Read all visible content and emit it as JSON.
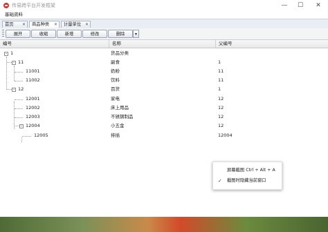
{
  "window": {
    "title": "传易跨平台开发框架",
    "controls": {
      "minimize": "—",
      "maximize": "☐",
      "close": "✕"
    }
  },
  "menu": {
    "items": [
      "基础资料"
    ]
  },
  "tabs": [
    {
      "label": "首页",
      "active": false
    },
    {
      "label": "商品种类",
      "active": true
    },
    {
      "label": "计量单位",
      "active": false
    }
  ],
  "tab_close_glyph": "✕",
  "toolbar": {
    "buttons": [
      "展开",
      "收缩",
      "新增",
      "修改",
      "删除"
    ],
    "more_glyph": "▾"
  },
  "grid": {
    "columns": [
      "编号",
      "名称",
      "父编号"
    ],
    "rows": [
      {
        "code": "1",
        "name": "货品分类",
        "parent": "",
        "level": 0,
        "expander": "-"
      },
      {
        "code": "11",
        "name": "副食",
        "parent": "1",
        "level": 1,
        "expander": "-"
      },
      {
        "code": "11001",
        "name": "奶粉",
        "parent": "11",
        "level": 2,
        "expander": ""
      },
      {
        "code": "11002",
        "name": "饮料",
        "parent": "11",
        "level": 2,
        "expander": ""
      },
      {
        "code": "12",
        "name": "百货",
        "parent": "1",
        "level": 1,
        "expander": "-"
      },
      {
        "code": "12001",
        "name": "家电",
        "parent": "12",
        "level": 2,
        "expander": ""
      },
      {
        "code": "12002",
        "name": "床上用品",
        "parent": "12",
        "level": 2,
        "expander": ""
      },
      {
        "code": "12003",
        "name": "不锈钢制品",
        "parent": "12",
        "level": 2,
        "expander": ""
      },
      {
        "code": "12004",
        "name": "小五金",
        "parent": "12",
        "level": 2,
        "expander": "-"
      },
      {
        "code": "12005",
        "name": "排插",
        "parent": "12004",
        "level": 3,
        "expander": ""
      }
    ]
  },
  "context_menu": {
    "items": [
      {
        "label": "屏幕截图 Ctrl + Alt + A",
        "checked": false
      },
      {
        "label": "截图时隐藏当前窗口",
        "checked": true
      }
    ],
    "check_glyph": "✓"
  }
}
